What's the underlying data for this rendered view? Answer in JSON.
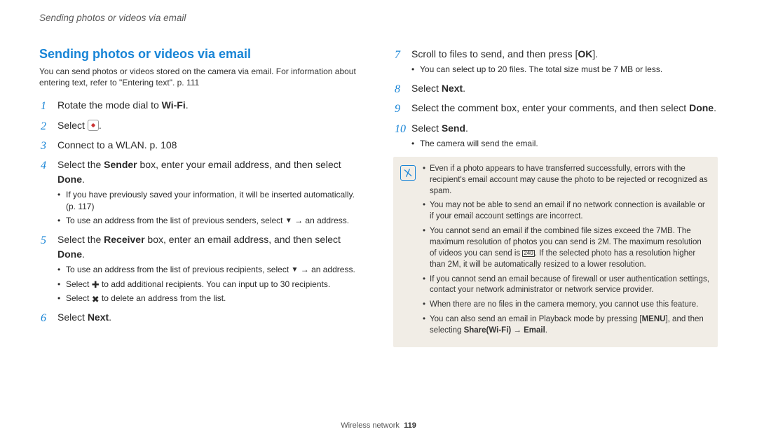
{
  "header": "Sending photos or videos via email",
  "title": "Sending photos or videos via email",
  "intro": "You can send photos or videos stored on the camera via email. For information about entering text, refer to \"Entering text\". p. 111",
  "steps_left": {
    "s1_pre": "Rotate the mode dial to ",
    "s1_wifi": "Wi-Fi",
    "s1_post": ".",
    "s2_pre": "Select ",
    "s2_post": ".",
    "s3": "Connect to a WLAN. p. 108",
    "s4_a": "Select the ",
    "s4_sender": "Sender",
    "s4_b": " box, enter your email address, and then select ",
    "s4_done": "Done",
    "s4_c": ".",
    "s4_sub1": "If you have previously saved your information, it will be inserted automatically. (p. 117)",
    "s4_sub2_a": "To use an address from the list of previous senders, select ",
    "s4_sub2_b": " → an address.",
    "s5_a": "Select the ",
    "s5_recv": "Receiver",
    "s5_b": " box, enter an email address, and then select ",
    "s5_done": "Done",
    "s5_c": ".",
    "s5_sub1_a": "To use an address from the list of previous recipients, select ",
    "s5_sub1_b": " → an address.",
    "s5_sub2_a": "Select ",
    "s5_sub2_b": " to add additional recipients. You can input up to 30 recipients.",
    "s5_sub3_a": "Select ",
    "s5_sub3_b": " to delete an address from the list.",
    "s6_a": "Select ",
    "s6_next": "Next",
    "s6_b": "."
  },
  "steps_right": {
    "s7_a": "Scroll to files to send, and then press [",
    "s7_ok": "OK",
    "s7_b": "].",
    "s7_sub1": "You can select up to 20 files. The total size must be 7 MB or less.",
    "s8_a": "Select ",
    "s8_next": "Next",
    "s8_b": ".",
    "s9_a": "Select the comment box, enter your comments, and then select ",
    "s9_done": "Done",
    "s9_b": ".",
    "s10_a": "Select ",
    "s10_send": "Send",
    "s10_b": ".",
    "s10_sub1": "The camera will send the email."
  },
  "notes": {
    "n1": "Even if a photo appears to have transferred successfully, errors with the recipient's email account may cause the photo to be rejected or recognized as spam.",
    "n2": "You may not be able to send an email if no network connection is available or if your email account settings are incorrect.",
    "n3_a": "You cannot send an email if the combined file sizes exceed the 7MB. The maximum resolution of photos you can send is 2M. The maximum resolution of videos you can send is ",
    "n3_b": ". If the selected photo has a resolution higher than 2M, it will be automatically resized to a lower resolution.",
    "n4": "If you cannot send an email because of firewall or user authentication settings, contact your network administrator or network service provider.",
    "n5": "When there are no files in the camera memory, you cannot use this feature.",
    "n6_a": "You can also send an email in Playback mode by pressing [",
    "n6_menu": "MENU",
    "n6_b": "], and then selecting ",
    "n6_share": "Share(Wi-Fi)",
    "n6_arrow": " → ",
    "n6_email": "Email",
    "n6_c": "."
  },
  "footer": {
    "section": "Wireless network",
    "page": "119"
  },
  "icons": {
    "down": "▼",
    "plus": "✚",
    "x": "✖",
    "res": "240"
  }
}
